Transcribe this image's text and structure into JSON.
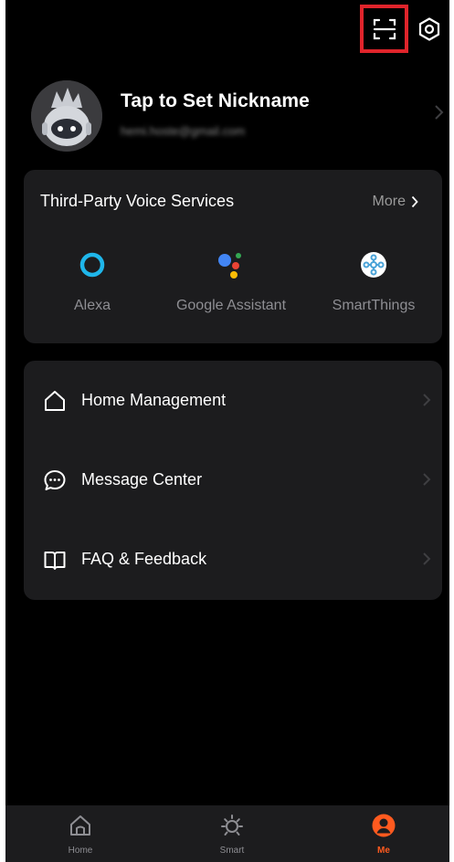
{
  "header": {
    "scan_icon": "scan-icon",
    "settings_icon": "settings-icon",
    "accent_highlight": "#e0242b"
  },
  "profile": {
    "nickname": "Tap to Set Nickname",
    "email": "hemi.hoste@gmail.com",
    "avatar_icon": "robot-avatar"
  },
  "voice_services": {
    "title": "Third-Party Voice Services",
    "more_label": "More",
    "items": [
      {
        "label": "Alexa",
        "icon": "alexa-icon"
      },
      {
        "label": "Google Assistant",
        "icon": "google-assistant-icon"
      },
      {
        "label": "SmartThings",
        "icon": "smartthings-icon"
      }
    ]
  },
  "menu": {
    "items": [
      {
        "label": "Home Management",
        "icon": "home-outline-icon"
      },
      {
        "label": "Message Center",
        "icon": "message-icon"
      },
      {
        "label": "FAQ & Feedback",
        "icon": "book-icon"
      }
    ]
  },
  "tabbar": {
    "active_color": "#ff5a1f",
    "tabs": [
      {
        "label": "Home",
        "icon": "home-icon",
        "active": false
      },
      {
        "label": "Smart",
        "icon": "sun-icon",
        "active": false
      },
      {
        "label": "Me",
        "icon": "person-icon",
        "active": true
      }
    ]
  }
}
